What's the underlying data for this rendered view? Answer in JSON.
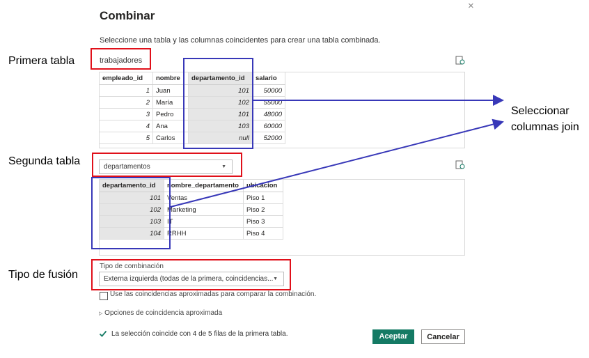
{
  "dialog": {
    "title": "Combinar",
    "close_glyph": "×",
    "subtitle": "Seleccione una tabla y las columnas coincidentes para crear una tabla combinada."
  },
  "annotations": {
    "first_table": "Primera tabla",
    "second_table": "Segunda tabla",
    "join_type": "Tipo de fusión",
    "select_columns_line1": "Seleccionar",
    "select_columns_line2": "columnas join"
  },
  "first_table": {
    "name": "trabajadores",
    "headers": [
      "empleado_id",
      "nombre",
      "departamento_id",
      "salario"
    ],
    "rows": [
      [
        "1",
        "Juan",
        "101",
        "50000"
      ],
      [
        "2",
        "María",
        "102",
        "55000"
      ],
      [
        "3",
        "Pedro",
        "101",
        "48000"
      ],
      [
        "4",
        "Ana",
        "103",
        "60000"
      ],
      [
        "5",
        "Carlos",
        "null",
        "52000"
      ]
    ]
  },
  "second_table": {
    "selected": "departamentos",
    "headers": [
      "departamento_id",
      "nombre_departamento",
      "ubicacion"
    ],
    "rows": [
      [
        "101",
        "Ventas",
        "Piso 1"
      ],
      [
        "102",
        "Marketing",
        "Piso 2"
      ],
      [
        "103",
        "IT",
        "Piso 3"
      ],
      [
        "104",
        "RRHH",
        "Piso 4"
      ]
    ]
  },
  "join": {
    "label": "Tipo de combinación",
    "selected": "Externa izquierda (todas de la primera, coincidencias..."
  },
  "fuzzy": {
    "checkbox_label": "Use las coincidencias aproximadas para comparar la combinación.",
    "options_label": "Opciones de coincidencia aproximada"
  },
  "status": {
    "text": "La selección coincide con 4 de 5 filas de la primera tabla.",
    "color": "#147a64"
  },
  "buttons": {
    "accept": "Aceptar",
    "cancel": "Cancelar"
  },
  "colors": {
    "accent": "#147a64",
    "annotation_red": "#e0101a",
    "annotation_blue": "#3838b8"
  },
  "icons": {
    "refresh": "refresh-preview-icon",
    "chevron": "chevron-down-icon",
    "check": "check-icon",
    "expand": "triangle-right-icon"
  }
}
